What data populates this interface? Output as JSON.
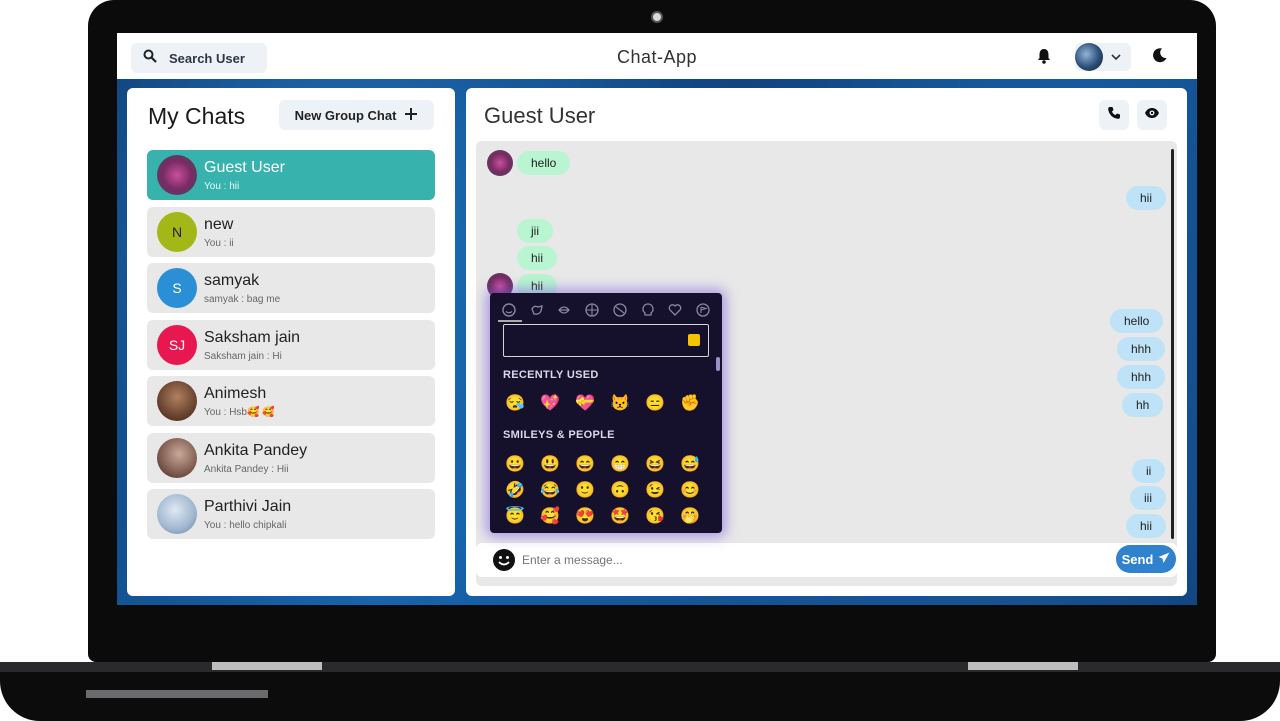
{
  "header": {
    "search_label": "Search User",
    "app_title": "Chat-App"
  },
  "my_chats": {
    "title": "My Chats",
    "new_group_label": "New Group Chat",
    "items": [
      {
        "name": "Guest User",
        "preview": "You : hii",
        "initials": "",
        "active": true
      },
      {
        "name": "new",
        "preview": "You : ii",
        "initials": "N"
      },
      {
        "name": "samyak",
        "preview": "samyak : bag me",
        "initials": "S"
      },
      {
        "name": "Saksham jain",
        "preview": "Saksham jain : Hi",
        "initials": "SJ"
      },
      {
        "name": "Animesh",
        "preview": "You : Hsb🥰 🥰",
        "initials": ""
      },
      {
        "name": "Ankita Pandey",
        "preview": "Ankita Pandey : Hii",
        "initials": ""
      },
      {
        "name": "Parthivi Jain",
        "preview": "You : hello chipkali",
        "initials": ""
      }
    ]
  },
  "chat": {
    "title": "Guest User",
    "messages": [
      {
        "text": "hello",
        "side": "in"
      },
      {
        "text": "hii",
        "side": "out"
      },
      {
        "text": "jii",
        "side": "in"
      },
      {
        "text": "hii",
        "side": "in"
      },
      {
        "text": "hii",
        "side": "in"
      },
      {
        "text": "hello",
        "side": "out"
      },
      {
        "text": "hhh",
        "side": "out"
      },
      {
        "text": "hhh",
        "side": "out"
      },
      {
        "text": "hh",
        "side": "out"
      },
      {
        "text": "ii",
        "side": "out"
      },
      {
        "text": "iii",
        "side": "out"
      },
      {
        "text": "hii",
        "side": "out"
      }
    ],
    "input_placeholder": "Enter a message...",
    "send_label": "Send"
  },
  "emoji_picker": {
    "recent_label": "RECENTLY USED",
    "smileys_label": "SMILEYS & PEOPLE",
    "recent": [
      "😪",
      "💖",
      "💝",
      "😾",
      "😑",
      "✊"
    ],
    "smileys": [
      [
        "😀",
        "😃",
        "😄",
        "😁",
        "😆",
        "😅"
      ],
      [
        "🤣",
        "😂",
        "🙂",
        "🙃",
        "😉",
        "😊"
      ],
      [
        "😇",
        "🥰",
        "😍",
        "🤩",
        "😘",
        "🤭"
      ]
    ],
    "categories": [
      "smileys-icon",
      "animals-icon",
      "food-icon",
      "travel-icon",
      "activity-icon",
      "objects-icon",
      "symbols-icon",
      "flags-icon"
    ]
  },
  "colors": {
    "accent_teal": "#38b2ac",
    "send_blue": "#3182ce",
    "incoming_bubble": "#b9f5d0",
    "outgoing_bubble": "#bee3f8",
    "picker_bg": "#15102b"
  }
}
